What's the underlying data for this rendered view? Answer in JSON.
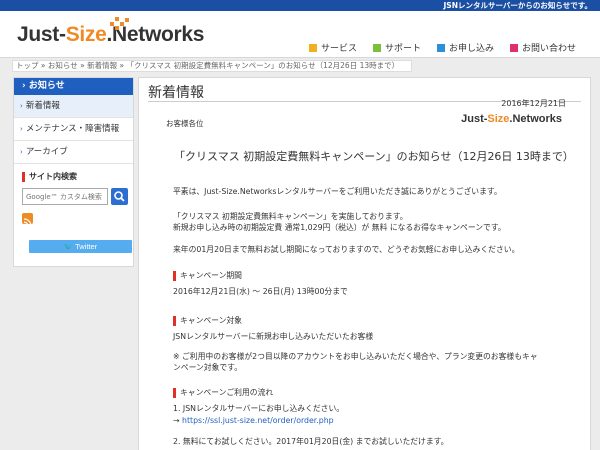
{
  "topbar": {
    "notice": "JSNレンタルサーバーからのお知らせです。"
  },
  "brand": {
    "part1": "Just-",
    "part2": "Size",
    "part3": ".Networks"
  },
  "nav": [
    {
      "label": "サービス",
      "color": "#f0b020"
    },
    {
      "label": "サポート",
      "color": "#7cc03a"
    },
    {
      "label": "お申し込み",
      "color": "#2d8fd5"
    },
    {
      "label": "お問い合わせ",
      "color": "#e0306a"
    }
  ],
  "breadcrumb": {
    "home": "トップ",
    "news": "お知らせ",
    "latest": "新着情報",
    "current": "「クリスマス 初期設定費無料キャンペーン」のお知らせ（12月26日 13時まで）",
    "sep": "»"
  },
  "sidebar": {
    "heading": "お知らせ",
    "items": [
      "新着情報",
      "メンテナンス・障害情報",
      "アーカイブ"
    ],
    "search_title": "サイト内検索",
    "search_placeholder": "Google™ カスタム検索",
    "twitter_label": "Twitter"
  },
  "main": {
    "title": "新着情報",
    "date": "2016年12月21日",
    "salutation": "お客様各位",
    "headline": "「クリスマス 初期設定費無料キャンペーン」のお知らせ（12月26日 13時まで）",
    "intro": "平素は、Just-Size.Networksレンタルサーバーをご利用いただき誠にありがとうございます。",
    "p2a": "「クリスマス 初期設定費無料キャンペーン」を実施しております。",
    "p2b": "新規お申し込み時の初期設定費 通常1,029円（税込）が 無料 になるお得なキャンペーンです。",
    "p3": "来年の01月20日まで無料お試し期間になっておりますので、どうぞお気軽にお申し込みください。",
    "period_title": "キャンペーン期間",
    "period": "2016年12月21日(水) 〜 26日(月) 13時00分まで",
    "target_title": "キャンペーン対象",
    "target": "JSNレンタルサーバーに新規お申し込みいただいたお客様",
    "note_a": "※ ご利用中のお客様が2つ目以降のアカウントをお申し込みいただく場合や、プラン変更のお客様もキャ",
    "note_b": "ンペーン対象です。",
    "flow_title": "キャンペーンご利用の流れ",
    "step1": "1. JSNレンタルサーバーにお申し込みください。",
    "arrow": "→ ",
    "step1_link": "https://ssl.just-size.net/order/order.php",
    "step2": "2. 無料にてお試しください。2017年01月20日(金) までお試しいただけます。"
  }
}
